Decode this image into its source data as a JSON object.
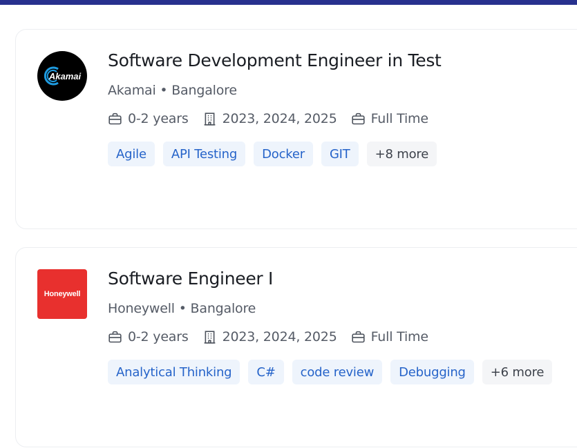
{
  "colors": {
    "topbar": "#28318e",
    "tag_bg": "#eef4fc",
    "tag_text": "#2563c9",
    "more_bg": "#f4f5f7",
    "honeywell_red": "#e8302e"
  },
  "jobs": [
    {
      "title": "Software Development Engineer in Test",
      "company_line": "Akamai • Bangalore",
      "logo_text": "Akamai",
      "experience": "0-2 years",
      "batches": "2023, 2024, 2025",
      "job_type": "Full Time",
      "icons": {
        "experience": "briefcase-icon",
        "batches": "building-icon",
        "job_type": "briefcase-icon"
      },
      "tags": [
        "Agile",
        "API Testing",
        "Docker",
        "GIT"
      ],
      "more": "+8 more"
    },
    {
      "title": "Software Engineer I",
      "company_line": "Honeywell • Bangalore",
      "logo_text": "Honeywell",
      "experience": "0-2 years",
      "batches": "2023, 2024, 2025",
      "job_type": "Full Time",
      "icons": {
        "experience": "briefcase-icon",
        "batches": "building-icon",
        "job_type": "briefcase-icon"
      },
      "tags": [
        "Analytical Thinking",
        "C#",
        "code review",
        "Debugging"
      ],
      "more": "+6 more"
    }
  ]
}
